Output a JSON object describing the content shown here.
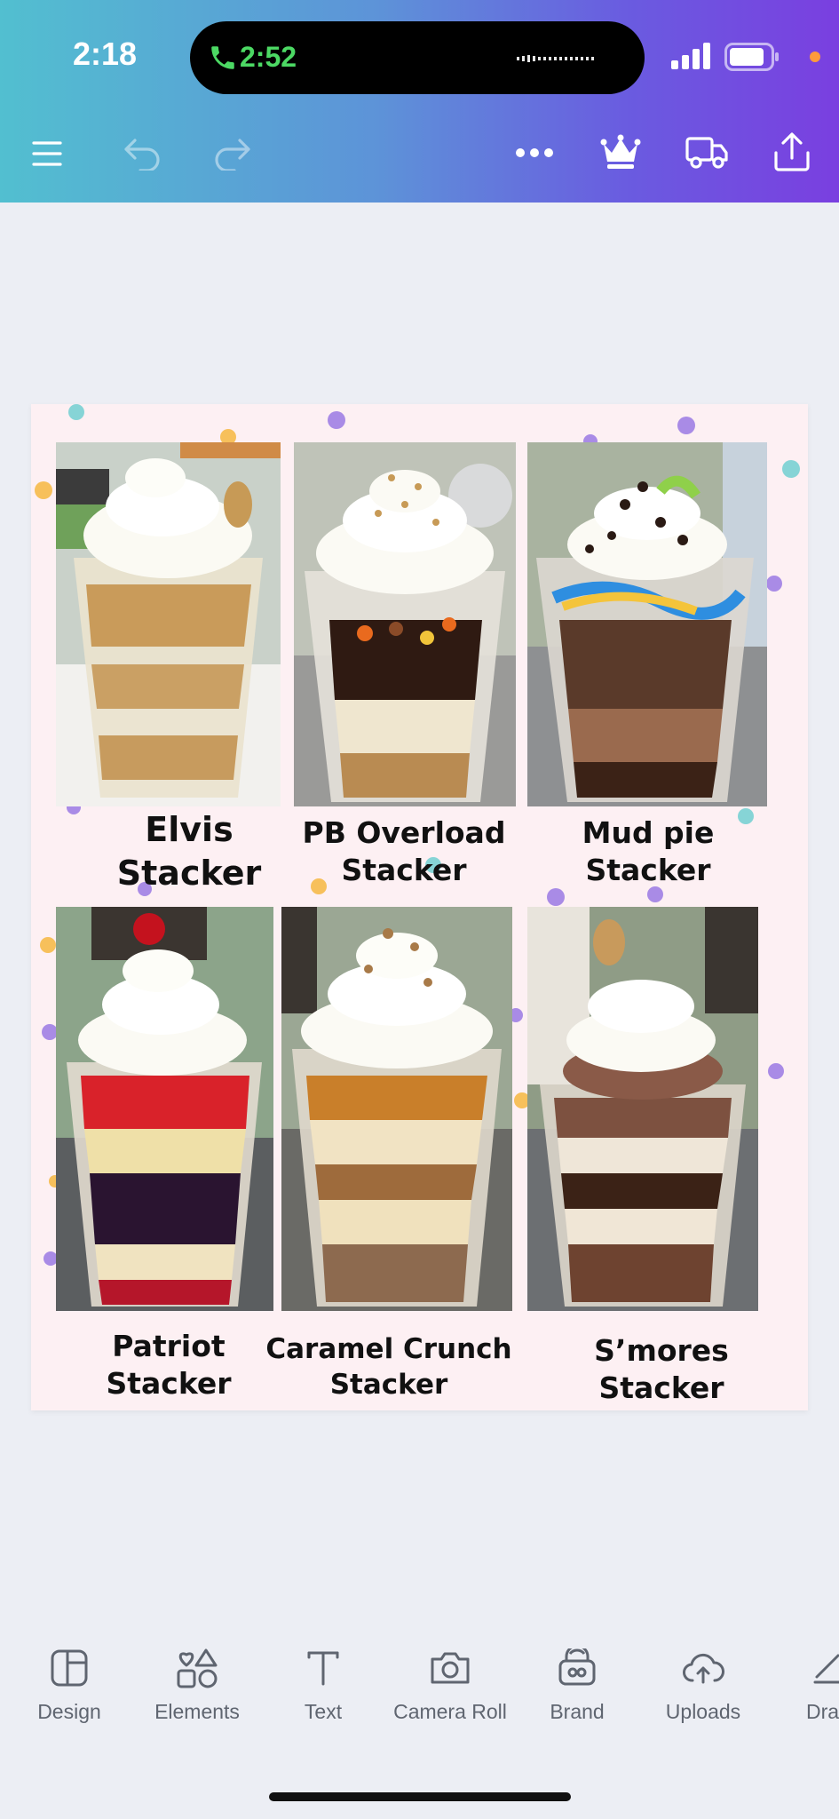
{
  "status_bar": {
    "time": "2:18",
    "call_time": "2:52",
    "call_color": "#4cd964"
  },
  "toolbar": {
    "icons": [
      "menu-icon",
      "undo-icon",
      "redo-icon",
      "more-icon",
      "crown-icon",
      "truck-icon",
      "share-icon"
    ],
    "gradient_colors": [
      "#52bfd0",
      "#6a5be0",
      "#7a3fe0"
    ]
  },
  "design": {
    "background": "#fdf0f3",
    "items": [
      {
        "line1": "Elvis",
        "line2": "Stacker"
      },
      {
        "line1": "PB Overload",
        "line2": "Stacker"
      },
      {
        "line1": "Mud pie",
        "line2": "Stacker"
      },
      {
        "line1": "Patriot",
        "line2": "Stacker"
      },
      {
        "line1": "Caramel Crunch",
        "line2": "Stacker"
      },
      {
        "line1": "S’mores",
        "line2": "Stacker"
      }
    ]
  },
  "bottom_tools": [
    {
      "label": "Design",
      "icon": "layout-icon"
    },
    {
      "label": "Elements",
      "icon": "shapes-icon"
    },
    {
      "label": "Text",
      "icon": "text-icon"
    },
    {
      "label": "Camera Roll",
      "icon": "camera-icon"
    },
    {
      "label": "Brand",
      "icon": "brand-icon"
    },
    {
      "label": "Uploads",
      "icon": "upload-cloud-icon"
    },
    {
      "label": "Dra",
      "icon": "draw-icon"
    }
  ]
}
